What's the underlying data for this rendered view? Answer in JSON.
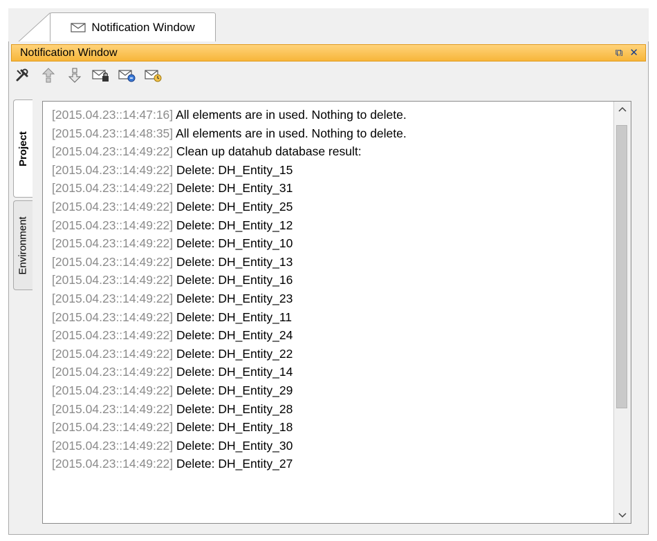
{
  "tab": {
    "title": "Notification Window",
    "icon": "envelope-icon"
  },
  "window": {
    "title": "Notification Window",
    "actions": [
      {
        "name": "restore-icon",
        "glyph": "⧉"
      },
      {
        "name": "close-icon",
        "glyph": "✕"
      }
    ]
  },
  "toolbar": {
    "tools": [
      "options-tools-icon",
      "previous-notification-icon",
      "next-notification-icon",
      "mail-lock-icon",
      "mail-refresh-icon",
      "mail-clock-icon"
    ]
  },
  "side_tabs": {
    "project": "Project",
    "environment": "Environment"
  },
  "log": {
    "lines": [
      {
        "ts": "[2015.04.23::14:47:16]",
        "msg": "All elements are in used. Nothing to delete."
      },
      {
        "ts": "[2015.04.23::14:48:35]",
        "msg": "All elements are in used. Nothing to delete."
      },
      {
        "ts": "[2015.04.23::14:49:22]",
        "msg": "Clean up datahub database result:"
      },
      {
        "ts": "[2015.04.23::14:49:22]",
        "msg": "Delete: DH_Entity_15"
      },
      {
        "ts": "[2015.04.23::14:49:22]",
        "msg": "Delete: DH_Entity_31"
      },
      {
        "ts": "[2015.04.23::14:49:22]",
        "msg": "Delete: DH_Entity_25"
      },
      {
        "ts": "[2015.04.23::14:49:22]",
        "msg": "Delete: DH_Entity_12"
      },
      {
        "ts": "[2015.04.23::14:49:22]",
        "msg": "Delete: DH_Entity_10"
      },
      {
        "ts": "[2015.04.23::14:49:22]",
        "msg": "Delete: DH_Entity_13"
      },
      {
        "ts": "[2015.04.23::14:49:22]",
        "msg": "Delete: DH_Entity_16"
      },
      {
        "ts": "[2015.04.23::14:49:22]",
        "msg": "Delete: DH_Entity_23"
      },
      {
        "ts": "[2015.04.23::14:49:22]",
        "msg": "Delete: DH_Entity_11"
      },
      {
        "ts": "[2015.04.23::14:49:22]",
        "msg": "Delete: DH_Entity_24"
      },
      {
        "ts": "[2015.04.23::14:49:22]",
        "msg": "Delete: DH_Entity_22"
      },
      {
        "ts": "[2015.04.23::14:49:22]",
        "msg": "Delete: DH_Entity_14"
      },
      {
        "ts": "[2015.04.23::14:49:22]",
        "msg": "Delete: DH_Entity_29"
      },
      {
        "ts": "[2015.04.23::14:49:22]",
        "msg": "Delete: DH_Entity_28"
      },
      {
        "ts": "[2015.04.23::14:49:22]",
        "msg": "Delete: DH_Entity_18"
      },
      {
        "ts": "[2015.04.23::14:49:22]",
        "msg": "Delete: DH_Entity_30"
      },
      {
        "ts": "[2015.04.23::14:49:22]",
        "msg": "Delete: DH_Entity_27"
      }
    ]
  },
  "colors": {
    "titlebar": "#f7b63a",
    "timestamp": "#8c8c8c",
    "accent": "#1a3f88"
  }
}
